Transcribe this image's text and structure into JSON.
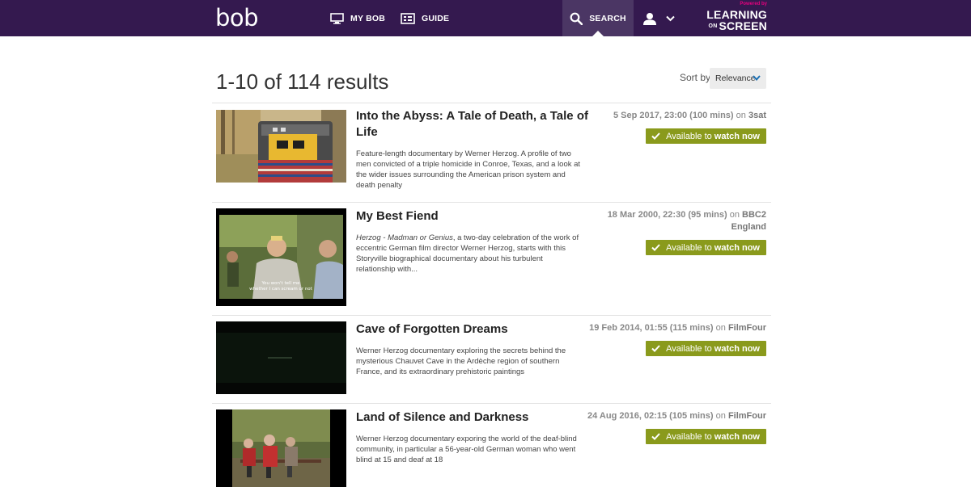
{
  "header": {
    "logo": "bob",
    "nav": {
      "mybob": "MY BOB",
      "guide": "GUIDE",
      "search": "SEARCH"
    },
    "partner": {
      "powered_by": "Powered by",
      "line1": "LEARNING",
      "on": "ON",
      "line2": "SCREEN"
    }
  },
  "results": {
    "count_text": "1-10 of 114 results",
    "sort_label": "Sort by",
    "sort_value": "Relevance"
  },
  "items": [
    {
      "title": "Into the Abyss: A Tale of Death, a Tale of Life",
      "description": "Feature-length documentary by Werner Herzog. A profile of two men convicted of a triple homicide in Conroe, Texas, and a look at the wider issues surrounding the American prison system and death penalty",
      "broadcast": "5 Sep 2017, 23:00 (100 mins)",
      "on": "on",
      "channel": "3sat",
      "avail_pre": "Available to",
      "avail_strong": "watch now"
    },
    {
      "title": "My Best Fiend",
      "description_em": "Herzog - Madman or Genius",
      "description": ", a two-day celebration of the work of eccentric German film director Werner Herzog, starts with this Storyville biographical documentary about his turbulent relationship with...",
      "broadcast": "18 Mar 2000, 22:30 (95 mins)",
      "on": "on",
      "channel": "BBC2 England",
      "thumb_subtitle_1": "You won't tell me",
      "thumb_subtitle_2": "whether I can scream or not",
      "avail_pre": "Available to",
      "avail_strong": "watch now"
    },
    {
      "title": "Cave of Forgotten Dreams",
      "description": "Werner Herzog documentary exploring the secrets behind the mysterious Chauvet Cave in the Ardèche region of southern France, and its extraordinary prehistoric paintings",
      "broadcast": "19 Feb 2014, 01:55 (115 mins)",
      "on": "on",
      "channel": "FilmFour",
      "avail_pre": "Available to",
      "avail_strong": "watch now"
    },
    {
      "title": "Land of Silence and Darkness",
      "description": "Werner Herzog documentary exporing the world of the deaf-blind community, in particular a 56-year-old German woman who went blind at 15 and deaf at 18",
      "broadcast": "24 Aug 2016, 02:15 (105 mins)",
      "on": "on",
      "channel": "FilmFour",
      "avail_pre": "Available to",
      "avail_strong": "watch now"
    }
  ],
  "colors": {
    "header_bg": "#34194f",
    "search_active_bg": "#4b3664",
    "available_green": "#8a9a1c",
    "brand_pink": "#e6007e"
  },
  "icons": [
    "tv-icon",
    "guide-icon",
    "search-icon",
    "user-icon",
    "chevron-down-icon",
    "checkmark-icon"
  ]
}
